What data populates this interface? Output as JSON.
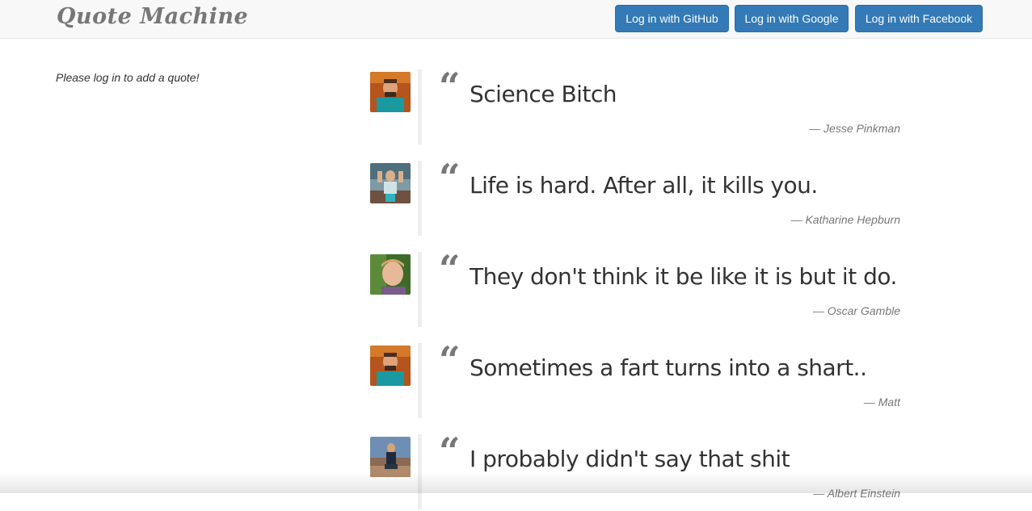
{
  "navbar": {
    "brand": "Quote Machine",
    "buttons": {
      "github": "Log in with GitHub",
      "google": "Log in with Google",
      "facebook": "Log in with Facebook"
    }
  },
  "sidebar": {
    "login_prompt": "Please log in to add a quote!"
  },
  "quotes": [
    {
      "text": "Science Bitch",
      "author": "— Jesse Pinkman",
      "avatar": "avatar-photo"
    },
    {
      "text": "Life is hard. After all, it kills you.",
      "author": "— Katharine Hepburn",
      "avatar": "avatar-photo"
    },
    {
      "text": "They don't think it be like it is but it do.",
      "author": "— Oscar Gamble",
      "avatar": "avatar-photo"
    },
    {
      "text": "Sometimes a fart turns into a shart..",
      "author": "— Matt",
      "avatar": "avatar-photo"
    },
    {
      "text": "I probably didn't say that shit",
      "author": "— Albert Einstein",
      "avatar": "avatar-photo"
    }
  ],
  "colors": {
    "primary_button": "#337ab7",
    "navbar_bg": "#f8f8f8",
    "quote_bar": "#eeeeee",
    "muted_text": "#777777"
  },
  "icons": {
    "quote_mark": "left-double-quote-icon"
  }
}
